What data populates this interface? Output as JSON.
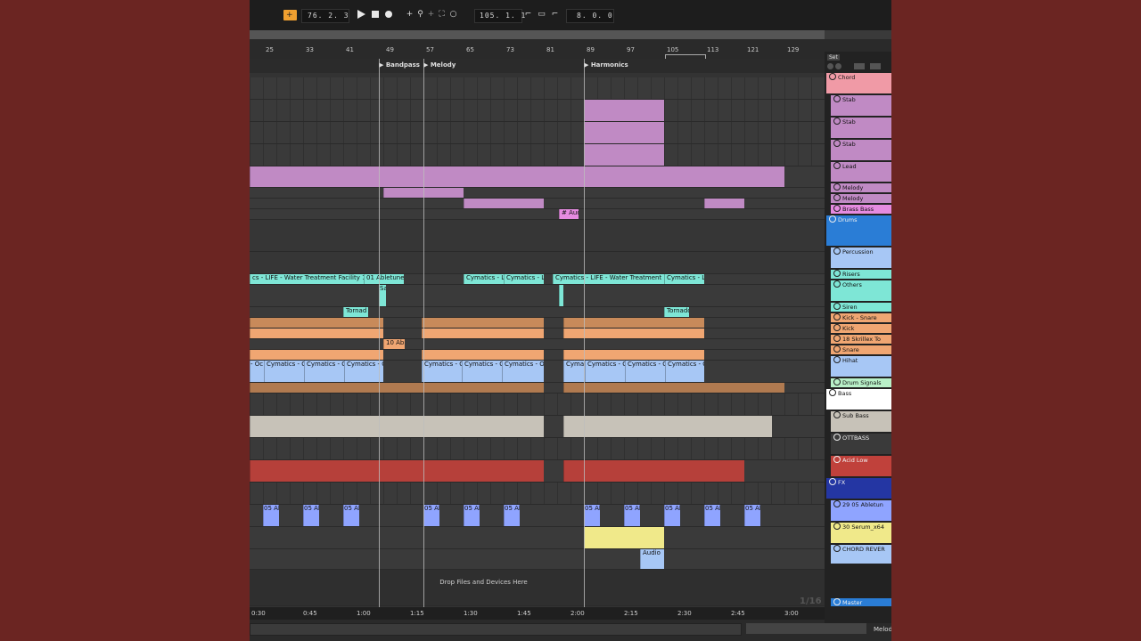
{
  "transport": {
    "arrangement_position": "76.  2.  3",
    "loop_start": "105.  1.  1",
    "loop_length": "8.  0.  0"
  },
  "ruler": [
    "25",
    "33",
    "41",
    "49",
    "57",
    "65",
    "73",
    "81",
    "89",
    "97",
    "105",
    "113",
    "121",
    "129"
  ],
  "locators": [
    "Bandpass",
    "Melody",
    "Harmonics"
  ],
  "clip_labels": {
    "water1": "cs - LIFE - Water Treatment Facility 1",
    "abletunes": "01 Abletunes",
    "cym_life1": "Cymatics - LIFE",
    "cym_life2": "Cymatics - LIFE",
    "water2": "Cymatics - LIFE - Water Treatment Fa",
    "cym_life3": "Cymatics - L",
    "audi": "# Audi",
    "sa": "Sa",
    "tornado1": "Tornad",
    "tornado2": "Tornado",
    "abl10": "10 Abl",
    "cym_oc": "Cymatics - Oc",
    "cym_oc_short": "- Oc",
    "cymat": "Cymat",
    "abl05": "05 Ab",
    "audio": "Audio"
  },
  "drop_text": "Drop Files and Devices Here",
  "grid_label": "1/16",
  "time_ruler": [
    "0:30",
    "0:45",
    "1:00",
    "1:15",
    "1:30",
    "1:45",
    "2:00",
    "2:15",
    "2:30",
    "2:45",
    "3:00"
  ],
  "panel": {
    "set_label": "Set",
    "tracks": [
      {
        "name": "Chord",
        "color": "#f09aa6"
      },
      {
        "name": "Stab",
        "color": "#c08ac4"
      },
      {
        "name": "Stab",
        "color": "#c08ac4"
      },
      {
        "name": "Stab",
        "color": "#c08ac4"
      },
      {
        "name": "Lead",
        "color": "#c08ac4"
      },
      {
        "name": "Melody",
        "color": "#c08ac4"
      },
      {
        "name": "Melody",
        "color": "#c08ac4"
      },
      {
        "name": "Brass Bass",
        "color": "#e58be0"
      },
      {
        "name": "Drums",
        "color": "#2a7dd6"
      },
      {
        "name": "Percussion",
        "color": "#a7c7f5"
      },
      {
        "name": "Risers",
        "color": "#7ee6d6"
      },
      {
        "name": "Others",
        "color": "#7ee6d6"
      },
      {
        "name": "Siren",
        "color": "#7ee6d6"
      },
      {
        "name": "Kick - Snare",
        "color": "#f0a672"
      },
      {
        "name": "Kick",
        "color": "#f0a672"
      },
      {
        "name": "18 Skrillex To",
        "color": "#f0a672"
      },
      {
        "name": "Snare",
        "color": "#f0a672"
      },
      {
        "name": "Hihat",
        "color": "#a7c7f5"
      },
      {
        "name": "Drum Signals",
        "color": "#b9f0c8"
      },
      {
        "name": "Bass",
        "color": "#ffffff"
      },
      {
        "name": "Sub Bass",
        "color": "#c7c2b8"
      },
      {
        "name": "OTTBASS",
        "color": "#3a3a3a"
      },
      {
        "name": "Acid Low",
        "color": "#c0413b"
      },
      {
        "name": "FX",
        "color": "#2436a3"
      },
      {
        "name": "29 05 Abletun",
        "color": "#8fa4ff"
      },
      {
        "name": "30 Serum_x64",
        "color": "#f0e98a"
      },
      {
        "name": "CHORD REVER",
        "color": "#a7c7f5"
      },
      {
        "name": "Master",
        "color": "#2a7dd6"
      }
    ]
  },
  "bottom_right_label": "Melod"
}
